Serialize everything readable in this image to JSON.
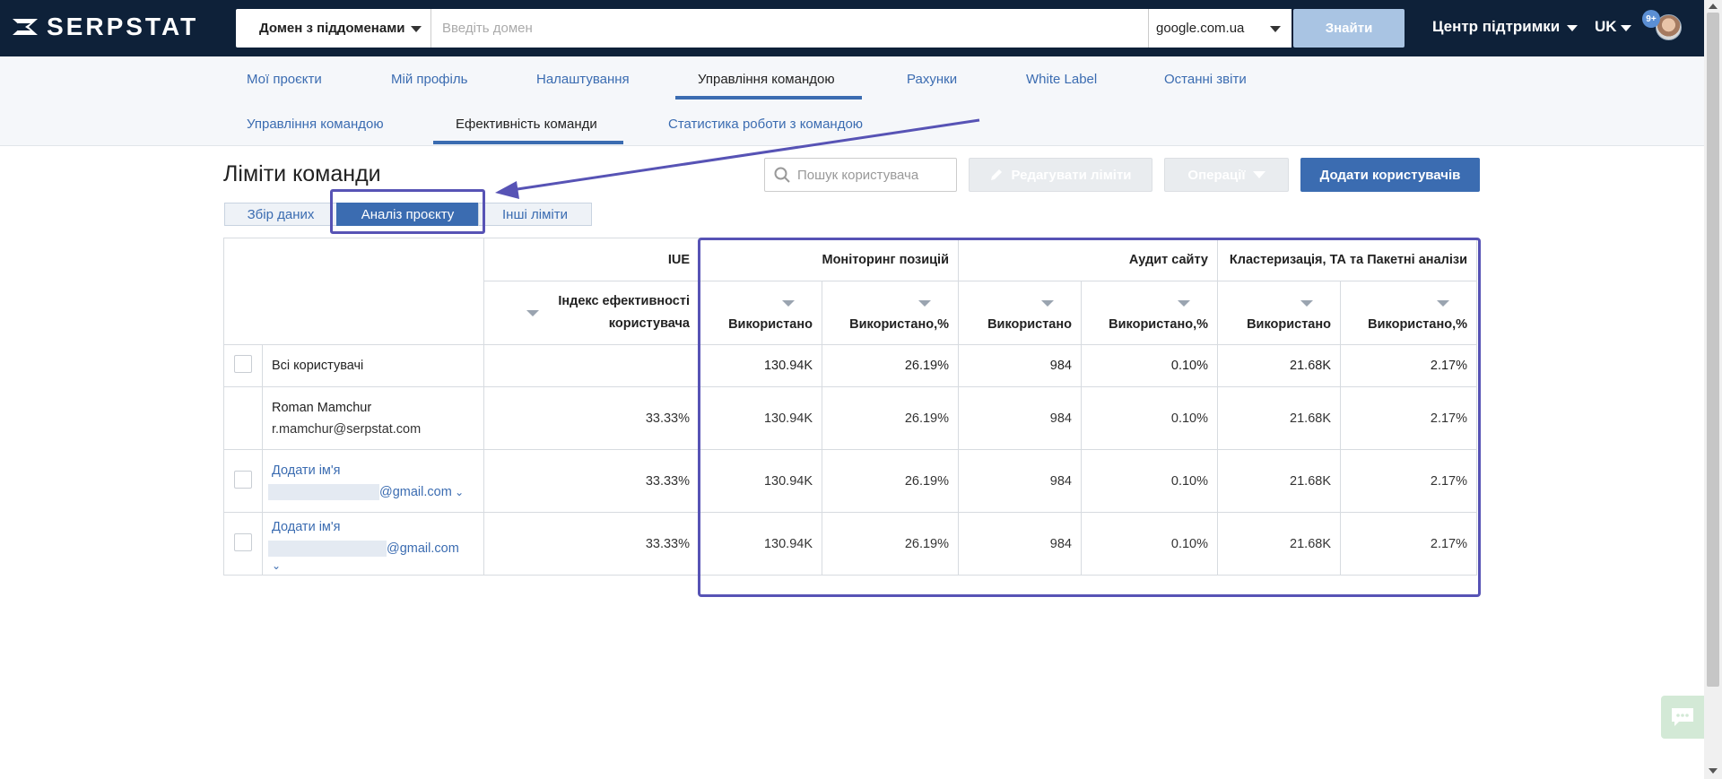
{
  "header": {
    "logo_text": "SERPSTAT",
    "domain_mode": "Домен з піддоменами",
    "domain_placeholder": "Введіть домен",
    "search_engine": "google.com.ua",
    "find_label": "Знайти",
    "support_label": "Центр підтримки",
    "language": "UK",
    "notifications_badge": "9+"
  },
  "nav": {
    "primary": [
      "Мої проєкти",
      "Мій профіль",
      "Налаштування",
      "Управління командою",
      "Рахунки",
      "White Label",
      "Останні звіти"
    ],
    "secondary": [
      "Управління командою",
      "Ефективність команди",
      "Статистика роботи з командою"
    ]
  },
  "page": {
    "title": "Ліміти команди",
    "search_placeholder": "Пошук користувача",
    "edit_limits_label": "Редагувати ліміти",
    "operations_label": "Операції",
    "add_users_label": "Додати користувачів",
    "limit_tabs": [
      "Збір даних",
      "Аналіз проєкту",
      "Інші ліміти"
    ]
  },
  "table": {
    "groups": [
      "IUE",
      "Моніторинг позицій",
      "Аудит сайту",
      "Кластеризація, ТА та Пакетні аналізи"
    ],
    "iue_header": "Індекс ефективності користувача",
    "used_header": "Використано",
    "used_pct_header": "Використано,%",
    "total": {
      "label": "Всі користувачі",
      "iue": "",
      "values": [
        "130.94K",
        "26.19%",
        "984",
        "0.10%",
        "21.68K",
        "2.17%"
      ]
    },
    "rows": [
      {
        "name": "Roman Mamchur",
        "email": "r.mamchur@serpstat.com",
        "iue": "33.33%",
        "values": [
          "130.94K",
          "26.19%",
          "984",
          "0.10%",
          "21.68K",
          "2.17%"
        ]
      },
      {
        "name": "Додати ім'я",
        "email": "@gmail.com",
        "iue": "33.33%",
        "values": [
          "130.94K",
          "26.19%",
          "984",
          "0.10%",
          "21.68K",
          "2.17%"
        ]
      },
      {
        "name": "Додати ім'я",
        "email": "@gmail.com",
        "iue": "33.33%",
        "values": [
          "130.94K",
          "26.19%",
          "984",
          "0.10%",
          "21.68K",
          "2.17%"
        ]
      }
    ]
  },
  "colors": {
    "topbar": "#0e2139",
    "accent": "#3b6cb1",
    "annotation": "#5753b5"
  }
}
